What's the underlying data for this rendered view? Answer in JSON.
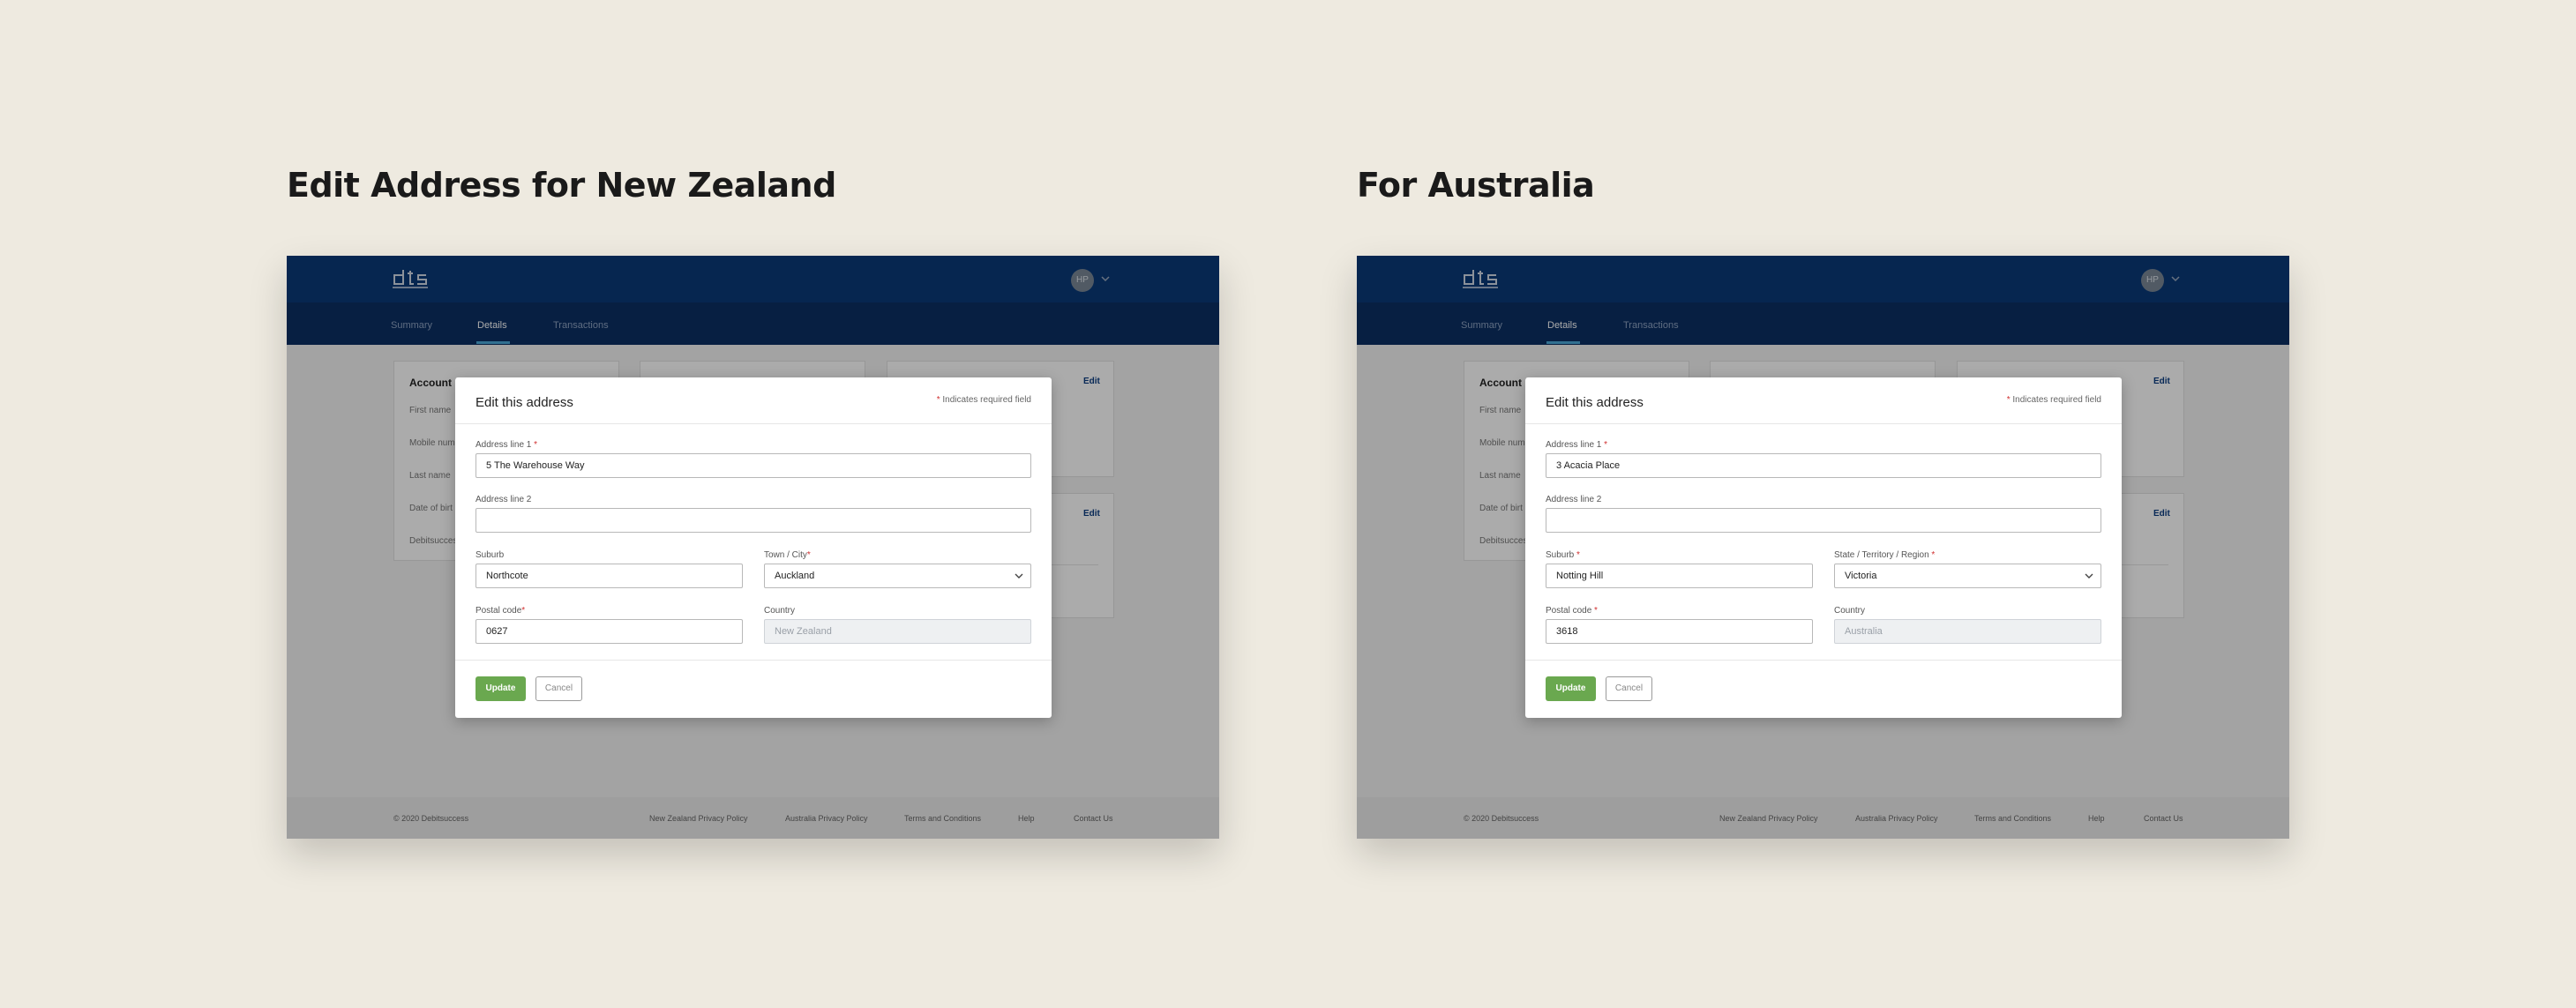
{
  "panels": {
    "nz": {
      "heading": "Edit Address for New Zealand",
      "subnav": {
        "summary": "Summary",
        "details": "Details",
        "transactions": "Transactions"
      },
      "avatar_initials": "HP",
      "bg_card": {
        "title": "Account D",
        "labels": [
          "First name",
          "Mobile num",
          "Last name",
          "Date of birt",
          "Debitsucces"
        ],
        "edit_1": "Edit",
        "edit_2": "Edit"
      },
      "footer": {
        "copyright": "© 2020 Debitsuccess",
        "nz_privacy": "New Zealand Privacy Policy",
        "au_privacy": "Australia Privacy Policy",
        "terms": "Terms and Conditions",
        "help": "Help",
        "contact": "Contact Us"
      },
      "modal": {
        "title": "Edit this address",
        "required_note": "Indicates required field",
        "address1_label": "Address line 1",
        "address1_value": "5 The Warehouse Way",
        "address2_label": "Address line 2",
        "address2_value": "",
        "suburb_label": "Suburb",
        "suburb_value": "Northcote",
        "city_label": "Town / City",
        "city_value": "Auckland",
        "postal_label": "Postal code",
        "postal_value": "0627",
        "country_label": "Country",
        "country_value": "New Zealand",
        "update_label": "Update",
        "cancel_label": "Cancel"
      }
    },
    "au": {
      "heading": "For Australia",
      "subnav": {
        "summary": "Summary",
        "details": "Details",
        "transactions": "Transactions"
      },
      "avatar_initials": "HP",
      "bg_card": {
        "title": "Account D",
        "labels": [
          "First name",
          "Mobile num",
          "Last name",
          "Date of birt",
          "Debitsucces"
        ],
        "edit_1": "Edit",
        "edit_2": "Edit"
      },
      "footer": {
        "copyright": "© 2020 Debitsuccess",
        "nz_privacy": "New Zealand Privacy Policy",
        "au_privacy": "Australia Privacy Policy",
        "terms": "Terms and Conditions",
        "help": "Help",
        "contact": "Contact Us"
      },
      "modal": {
        "title": "Edit this address",
        "required_note": "Indicates required field",
        "address1_label": "Address line 1",
        "address1_value": "3 Acacia Place",
        "address2_label": "Address line 2",
        "address2_value": "",
        "suburb_label": "Suburb",
        "suburb_value": "Notting Hill",
        "state_label": "State / Territory / Region",
        "state_value": "Victoria",
        "postal_label": "Postal code",
        "postal_value": "3618",
        "country_label": "Country",
        "country_value": "Australia",
        "update_label": "Update",
        "cancel_label": "Cancel"
      }
    }
  },
  "colors": {
    "page_bg": "#eeeae0",
    "topbar": "#0a3a78",
    "subnav": "#0b2f63",
    "update_button": "#6aa84f",
    "required_star": "#d03030"
  },
  "icons": [
    "logo-icon",
    "chevron-down-icon"
  ]
}
